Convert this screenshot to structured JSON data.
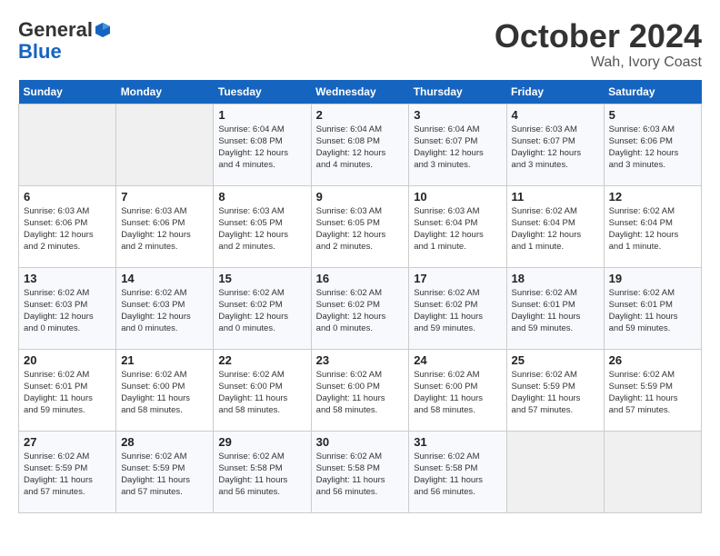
{
  "header": {
    "logo_general": "General",
    "logo_blue": "Blue",
    "month": "October 2024",
    "location": "Wah, Ivory Coast"
  },
  "weekdays": [
    "Sunday",
    "Monday",
    "Tuesday",
    "Wednesday",
    "Thursday",
    "Friday",
    "Saturday"
  ],
  "weeks": [
    [
      {
        "day": "",
        "info": ""
      },
      {
        "day": "",
        "info": ""
      },
      {
        "day": "1",
        "info": "Sunrise: 6:04 AM\nSunset: 6:08 PM\nDaylight: 12 hours\nand 4 minutes."
      },
      {
        "day": "2",
        "info": "Sunrise: 6:04 AM\nSunset: 6:08 PM\nDaylight: 12 hours\nand 4 minutes."
      },
      {
        "day": "3",
        "info": "Sunrise: 6:04 AM\nSunset: 6:07 PM\nDaylight: 12 hours\nand 3 minutes."
      },
      {
        "day": "4",
        "info": "Sunrise: 6:03 AM\nSunset: 6:07 PM\nDaylight: 12 hours\nand 3 minutes."
      },
      {
        "day": "5",
        "info": "Sunrise: 6:03 AM\nSunset: 6:06 PM\nDaylight: 12 hours\nand 3 minutes."
      }
    ],
    [
      {
        "day": "6",
        "info": "Sunrise: 6:03 AM\nSunset: 6:06 PM\nDaylight: 12 hours\nand 2 minutes."
      },
      {
        "day": "7",
        "info": "Sunrise: 6:03 AM\nSunset: 6:06 PM\nDaylight: 12 hours\nand 2 minutes."
      },
      {
        "day": "8",
        "info": "Sunrise: 6:03 AM\nSunset: 6:05 PM\nDaylight: 12 hours\nand 2 minutes."
      },
      {
        "day": "9",
        "info": "Sunrise: 6:03 AM\nSunset: 6:05 PM\nDaylight: 12 hours\nand 2 minutes."
      },
      {
        "day": "10",
        "info": "Sunrise: 6:03 AM\nSunset: 6:04 PM\nDaylight: 12 hours\nand 1 minute."
      },
      {
        "day": "11",
        "info": "Sunrise: 6:02 AM\nSunset: 6:04 PM\nDaylight: 12 hours\nand 1 minute."
      },
      {
        "day": "12",
        "info": "Sunrise: 6:02 AM\nSunset: 6:04 PM\nDaylight: 12 hours\nand 1 minute."
      }
    ],
    [
      {
        "day": "13",
        "info": "Sunrise: 6:02 AM\nSunset: 6:03 PM\nDaylight: 12 hours\nand 0 minutes."
      },
      {
        "day": "14",
        "info": "Sunrise: 6:02 AM\nSunset: 6:03 PM\nDaylight: 12 hours\nand 0 minutes."
      },
      {
        "day": "15",
        "info": "Sunrise: 6:02 AM\nSunset: 6:02 PM\nDaylight: 12 hours\nand 0 minutes."
      },
      {
        "day": "16",
        "info": "Sunrise: 6:02 AM\nSunset: 6:02 PM\nDaylight: 12 hours\nand 0 minutes."
      },
      {
        "day": "17",
        "info": "Sunrise: 6:02 AM\nSunset: 6:02 PM\nDaylight: 11 hours\nand 59 minutes."
      },
      {
        "day": "18",
        "info": "Sunrise: 6:02 AM\nSunset: 6:01 PM\nDaylight: 11 hours\nand 59 minutes."
      },
      {
        "day": "19",
        "info": "Sunrise: 6:02 AM\nSunset: 6:01 PM\nDaylight: 11 hours\nand 59 minutes."
      }
    ],
    [
      {
        "day": "20",
        "info": "Sunrise: 6:02 AM\nSunset: 6:01 PM\nDaylight: 11 hours\nand 59 minutes."
      },
      {
        "day": "21",
        "info": "Sunrise: 6:02 AM\nSunset: 6:00 PM\nDaylight: 11 hours\nand 58 minutes."
      },
      {
        "day": "22",
        "info": "Sunrise: 6:02 AM\nSunset: 6:00 PM\nDaylight: 11 hours\nand 58 minutes."
      },
      {
        "day": "23",
        "info": "Sunrise: 6:02 AM\nSunset: 6:00 PM\nDaylight: 11 hours\nand 58 minutes."
      },
      {
        "day": "24",
        "info": "Sunrise: 6:02 AM\nSunset: 6:00 PM\nDaylight: 11 hours\nand 58 minutes."
      },
      {
        "day": "25",
        "info": "Sunrise: 6:02 AM\nSunset: 5:59 PM\nDaylight: 11 hours\nand 57 minutes."
      },
      {
        "day": "26",
        "info": "Sunrise: 6:02 AM\nSunset: 5:59 PM\nDaylight: 11 hours\nand 57 minutes."
      }
    ],
    [
      {
        "day": "27",
        "info": "Sunrise: 6:02 AM\nSunset: 5:59 PM\nDaylight: 11 hours\nand 57 minutes."
      },
      {
        "day": "28",
        "info": "Sunrise: 6:02 AM\nSunset: 5:59 PM\nDaylight: 11 hours\nand 57 minutes."
      },
      {
        "day": "29",
        "info": "Sunrise: 6:02 AM\nSunset: 5:58 PM\nDaylight: 11 hours\nand 56 minutes."
      },
      {
        "day": "30",
        "info": "Sunrise: 6:02 AM\nSunset: 5:58 PM\nDaylight: 11 hours\nand 56 minutes."
      },
      {
        "day": "31",
        "info": "Sunrise: 6:02 AM\nSunset: 5:58 PM\nDaylight: 11 hours\nand 56 minutes."
      },
      {
        "day": "",
        "info": ""
      },
      {
        "day": "",
        "info": ""
      }
    ]
  ]
}
